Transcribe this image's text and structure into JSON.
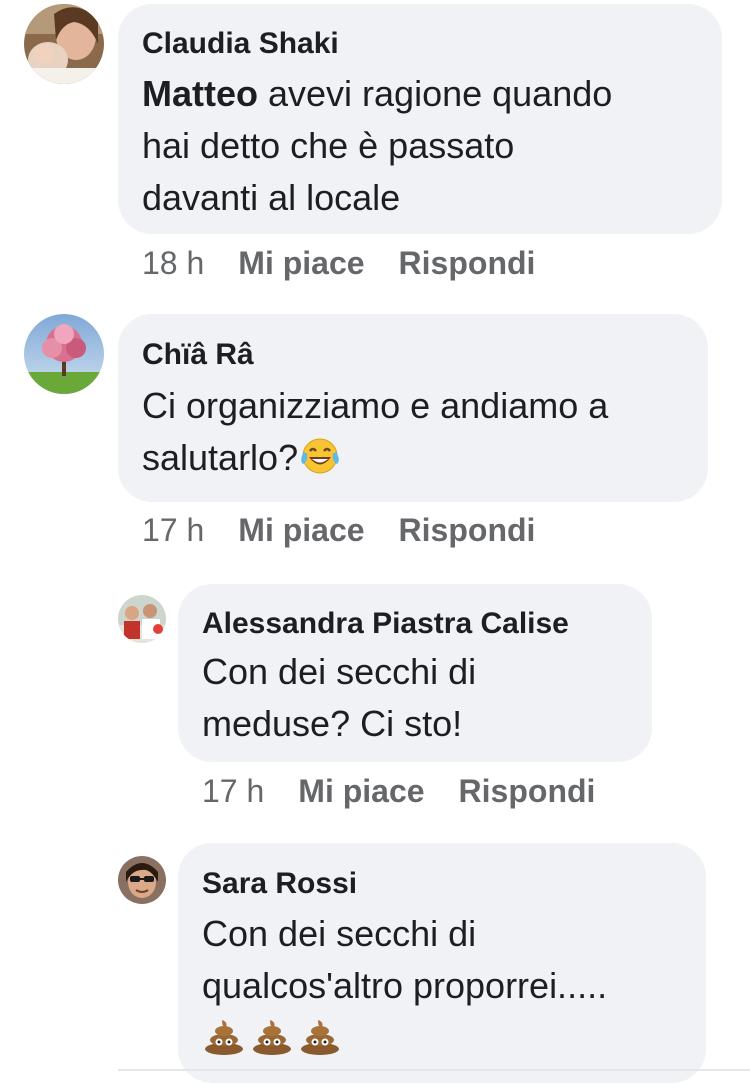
{
  "comments": [
    {
      "author": "Claudia Shaki",
      "mention": "Matteo",
      "text_line1": " avevi ragione quando",
      "text_line2": "hai detto che è passato",
      "text_line3": "davanti al locale",
      "time": "18 h",
      "like_label": "Mi piace",
      "reply_label": "Rispondi",
      "avatar_icon": "profile-photo-woman-with-baby"
    },
    {
      "author": "Chïâ Râ",
      "text_line1": "Ci organizziamo e andiamo a",
      "text_line2": "salutarlo?",
      "emoji": "tears-of-joy-emoji",
      "time": "17 h",
      "like_label": "Mi piace",
      "reply_label": "Rispondi",
      "avatar_icon": "profile-photo-pink-tree"
    },
    {
      "author": "Alessandra Piastra Calise",
      "text_line1": "Con dei secchi di",
      "text_line2": "meduse? Ci sto!",
      "time": "17 h",
      "like_label": "Mi piace",
      "reply_label": "Rispondi",
      "avatar_icon": "profile-photo-group"
    },
    {
      "author": "Sara Rossi",
      "text_line1": "Con dei secchi di",
      "text_line2": "qualcos'altro proporrei.....",
      "emoji": "pile-of-poo-emoji x3",
      "avatar_icon": "profile-photo-sunglasses"
    }
  ],
  "colors": {
    "bubble": "#f0f2f5",
    "text": "#1c1e21",
    "meta": "#65676b"
  }
}
